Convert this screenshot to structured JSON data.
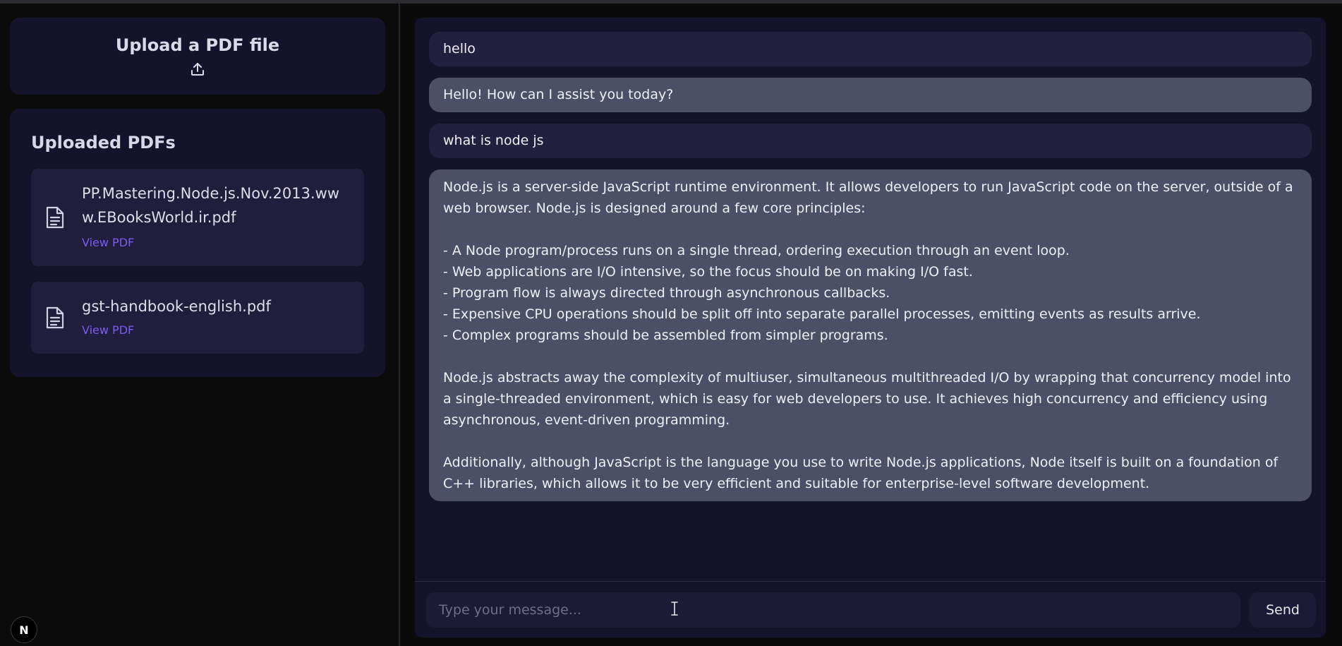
{
  "sidebar": {
    "upload": {
      "title": "Upload a PDF file",
      "icon": "upload-icon"
    },
    "uploaded": {
      "title": "Uploaded PDFs",
      "items": [
        {
          "name": "PP.Mastering.Node.js.Nov.2013.www.EBooksWorld.ir.pdf",
          "link": "View PDF",
          "icon": "document-icon"
        },
        {
          "name": "gst-handbook-english.pdf",
          "link": "View PDF",
          "icon": "document-icon"
        }
      ]
    }
  },
  "badge": {
    "letter": "N"
  },
  "chat": {
    "messages": [
      {
        "role": "user",
        "text": "hello"
      },
      {
        "role": "assistant",
        "text": "Hello! How can I assist you today?"
      },
      {
        "role": "user",
        "text": "what is node js"
      },
      {
        "role": "assistant",
        "intro": "Node.js is a server-side JavaScript runtime environment. It allows developers to run JavaScript code on the server, outside of a web browser. Node.js is designed around a few core principles:",
        "bullets": [
          "- A Node program/process runs on a single thread, ordering execution through an event loop.",
          "- Web applications are I/O intensive, so the focus should be on making I/O fast.",
          "- Program flow is always directed through asynchronous callbacks.",
          "- Expensive CPU operations should be split off into separate parallel processes, emitting events as results arrive.",
          "- Complex programs should be assembled from simpler programs."
        ],
        "para2": "Node.js abstracts away the complexity of multiuser, simultaneous multithreaded I/O by wrapping that concurrency model into a single-threaded environment, which is easy for web developers to use. It achieves high concurrency and efficiency using asynchronous, event-driven programming.",
        "para3": "Additionally, although JavaScript is the language you use to write Node.js applications, Node itself is built on a foundation of C++ libraries, which allows it to be very efficient and suitable for enterprise-level software development."
      }
    ],
    "input": {
      "placeholder": "Type your message...",
      "value": ""
    },
    "send_label": "Send"
  }
}
